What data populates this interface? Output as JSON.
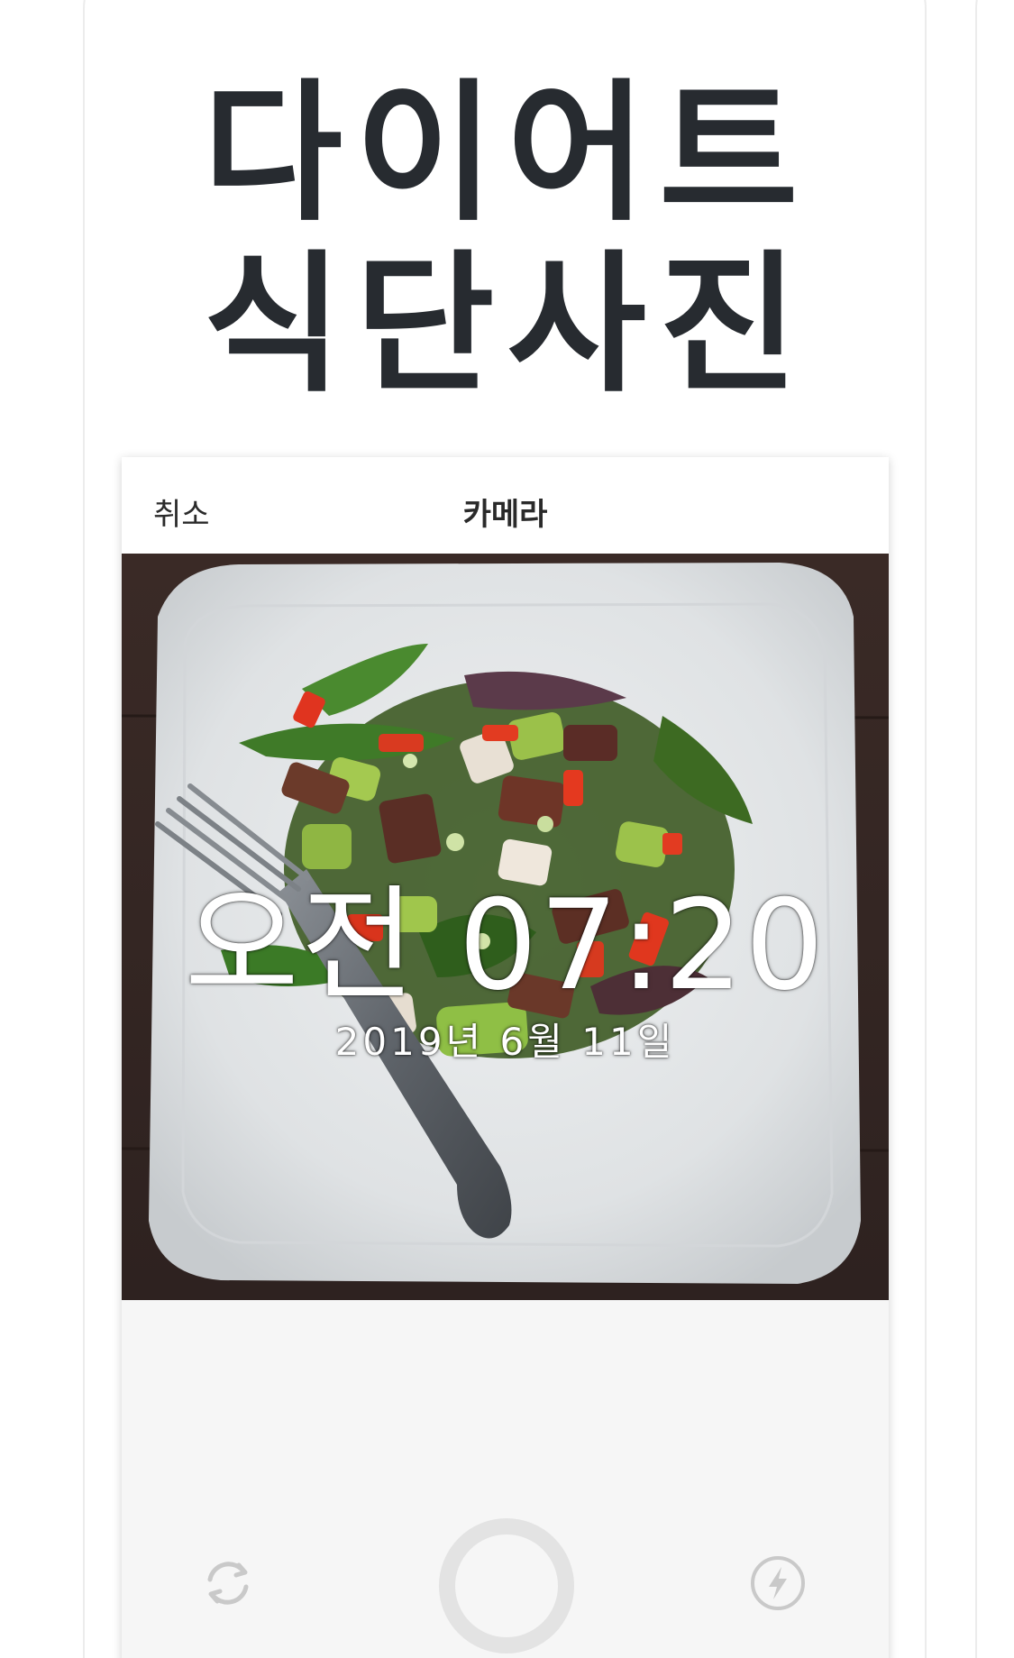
{
  "headline": {
    "line1": "다이어트",
    "line2": "식단사진"
  },
  "navbar": {
    "cancel_label": "취소",
    "title": "카메라"
  },
  "overlay": {
    "time": "오전 07:20",
    "date": "2019년 6월 11일"
  },
  "controls": {
    "flip_icon": "camera-flip-icon",
    "shutter_icon": "shutter-ring-icon",
    "flash_icon": "flash-icon"
  },
  "colors": {
    "headline": "#272b30",
    "background": "#ffffff",
    "controls_bg": "#f6f6f6",
    "icon_gray": "#c9c9c9",
    "overlay_text": "#ffffff"
  }
}
